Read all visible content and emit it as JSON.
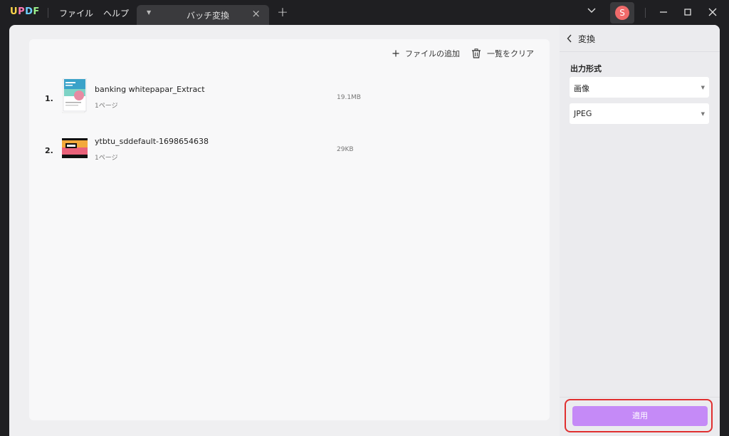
{
  "app": {
    "logo": [
      "U",
      "P",
      "D",
      "F"
    ]
  },
  "menu": {
    "file": "ファイル",
    "help": "ヘルプ"
  },
  "tab": {
    "label": "バッチ変換"
  },
  "user": {
    "avatar_letter": "S"
  },
  "toolbar": {
    "add_files": "ファイルの追加",
    "clear_list": "一覧をクリア"
  },
  "files": [
    {
      "index": "1.",
      "name": "banking whitepapar_Extract",
      "pages": "1ページ",
      "size": "19.1MB"
    },
    {
      "index": "2.",
      "name": "ytbtu_sddefault-1698654638",
      "pages": "1ページ",
      "size": "29KB"
    }
  ],
  "side": {
    "title": "変換",
    "format_label": "出力形式",
    "format_type": "画像",
    "format_subtype": "JPEG",
    "apply_label": "適用"
  },
  "colors": {
    "accent": "#c58af7",
    "highlight": "#e03030"
  }
}
